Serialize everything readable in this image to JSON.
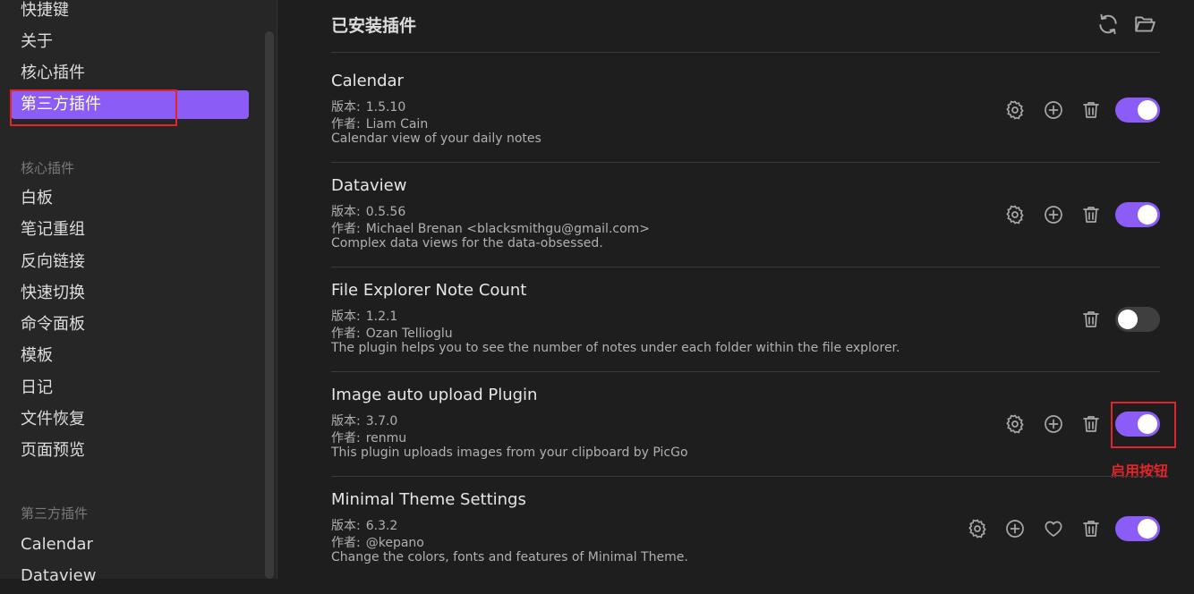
{
  "sidebar": {
    "top_items": [
      "快捷键",
      "关于",
      "核心插件",
      "第三方插件"
    ],
    "active_item": "第三方插件",
    "core_heading": "核心插件",
    "core_items": [
      "白板",
      "笔记重组",
      "反向链接",
      "快速切换",
      "命令面板",
      "模板",
      "日记",
      "文件恢复",
      "页面预览"
    ],
    "third_party_heading": "第三方插件",
    "third_party_items": [
      "Calendar",
      "Dataview"
    ]
  },
  "main": {
    "title": "已安装插件",
    "header_icons": [
      "refresh-icon",
      "folder-open-icon"
    ],
    "version_label": "版本:",
    "author_label": "作者:",
    "plugins": [
      {
        "name": "Calendar",
        "version": "1.5.10",
        "author": "Liam Cain",
        "description": "Calendar view of your daily notes",
        "actions": [
          "gear-icon",
          "plus-circle-icon",
          "trash-icon"
        ],
        "enabled": true
      },
      {
        "name": "Dataview",
        "version": "0.5.56",
        "author": "Michael Brenan <blacksmithgu@gmail.com>",
        "description": "Complex data views for the data-obsessed.",
        "actions": [
          "gear-icon",
          "plus-circle-icon",
          "trash-icon"
        ],
        "enabled": true
      },
      {
        "name": "File Explorer Note Count",
        "version": "1.2.1",
        "author": "Ozan Tellioglu",
        "description": "The plugin helps you to see the number of notes under each folder within the file explorer.",
        "actions": [
          "trash-icon"
        ],
        "enabled": false
      },
      {
        "name": "Image auto upload Plugin",
        "version": "3.7.0",
        "author": "renmu",
        "description": "This plugin uploads images from your clipboard by PicGo",
        "actions": [
          "gear-icon",
          "plus-circle-icon",
          "trash-icon"
        ],
        "enabled": true
      },
      {
        "name": "Minimal Theme Settings",
        "version": "6.3.2",
        "author": "@kepano",
        "description": "Change the colors, fonts and features of Minimal Theme.",
        "actions": [
          "gear-icon",
          "plus-circle-icon",
          "heart-icon",
          "trash-icon"
        ],
        "enabled": true
      }
    ]
  },
  "annotation": {
    "label": "启用按钮"
  },
  "colors": {
    "accent": "#8b5cf6",
    "annotation_red": "#e0262b",
    "background": "#1e1e1e",
    "sidebar_background": "#262626"
  }
}
